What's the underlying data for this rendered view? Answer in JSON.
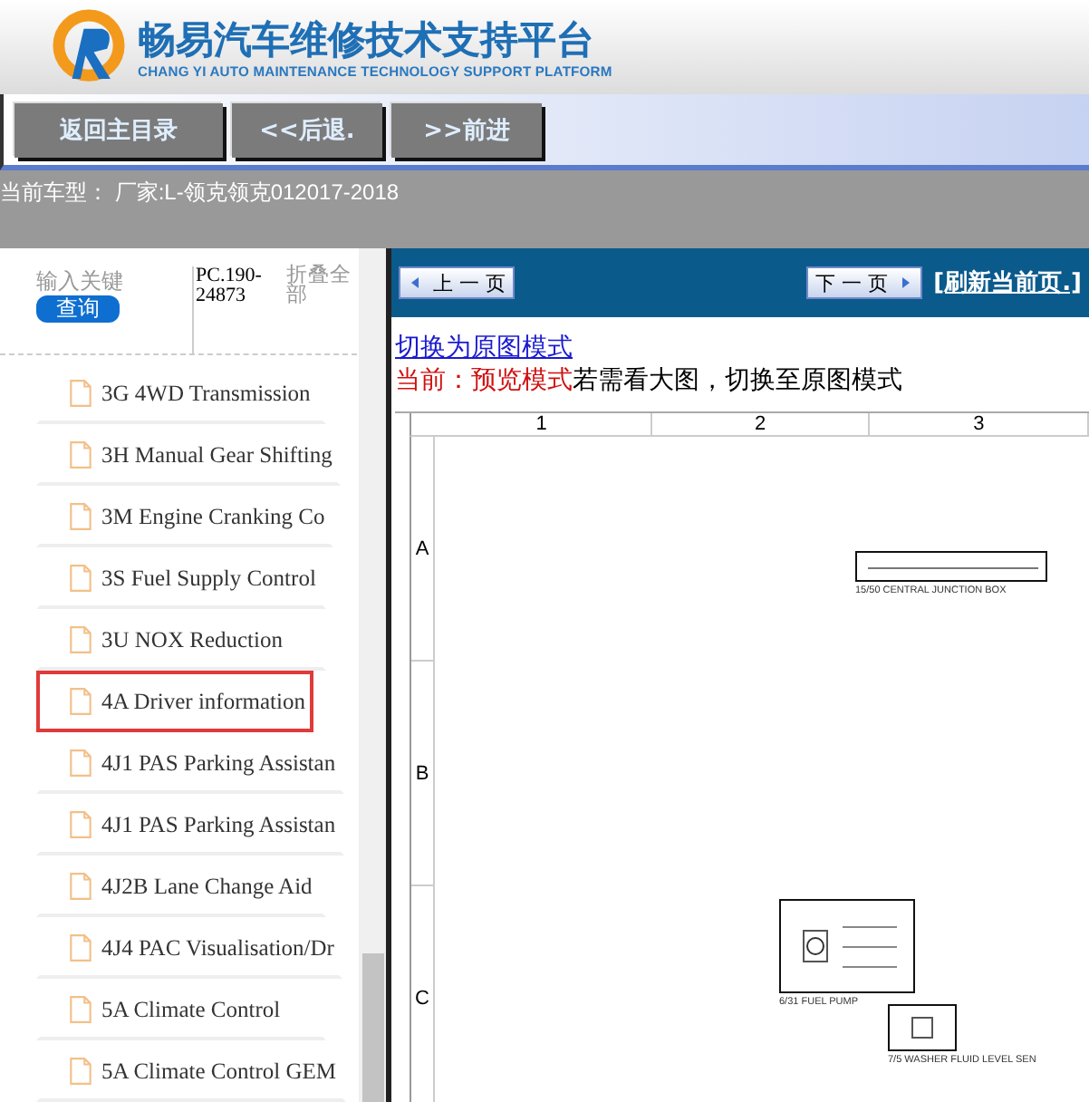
{
  "header": {
    "title": "畅易汽车维修技术支持平台",
    "subtitle": "CHANG YI AUTO MAINTENANCE TECHNOLOGY SUPPORT PLATFORM"
  },
  "nav_buttons": [
    "返回主目录",
    "<<后退.",
    ">>前进"
  ],
  "current_model": "当前车型： 厂家:L-领克领克012017-2018",
  "sidebar": {
    "search": {
      "placeholder": "输入关键"
    },
    "search_button": "查询",
    "code": "PC.190-24873",
    "collapse_link": "折叠全部",
    "items": [
      {
        "label": "3G 4WD Transmission",
        "selected": false
      },
      {
        "label": "3H Manual Gear Shifting",
        "selected": false
      },
      {
        "label": "3M Engine Cranking Co",
        "selected": false
      },
      {
        "label": "3S Fuel Supply Control",
        "selected": false
      },
      {
        "label": "3U NOX Reduction",
        "selected": false
      },
      {
        "label": "4A Driver information",
        "selected": true
      },
      {
        "label": "4J1 PAS Parking Assistan",
        "selected": false
      },
      {
        "label": "4J1 PAS Parking Assistan",
        "selected": false
      },
      {
        "label": "4J2B Lane Change Aid",
        "selected": false
      },
      {
        "label": "4J4 PAC Visualisation/Dr",
        "selected": false
      },
      {
        "label": "5A Climate Control",
        "selected": false
      },
      {
        "label": "5A Climate Control GEM",
        "selected": false
      }
    ]
  },
  "toolbar": {
    "prev": "上 一 页",
    "next": "下 一 页",
    "refresh": "[刷新当前页.]"
  },
  "content": {
    "switch_link": "切换为原图模式",
    "mode_label": "当前：预览模式",
    "mode_hint": "若需看大图，切换至原图模式",
    "diagram": {
      "columns": [
        "1",
        "2",
        "3"
      ],
      "rows": [
        "A",
        "B",
        "C"
      ],
      "components": [
        {
          "kind": "junction",
          "label": "15/50  CENTRAL JUNCTION BOX"
        },
        {
          "kind": "pump",
          "label": "6/31  FUEL PUMP"
        },
        {
          "kind": "sensor",
          "label": "7/5  WASHER FLUID LEVEL SEN"
        }
      ]
    }
  }
}
